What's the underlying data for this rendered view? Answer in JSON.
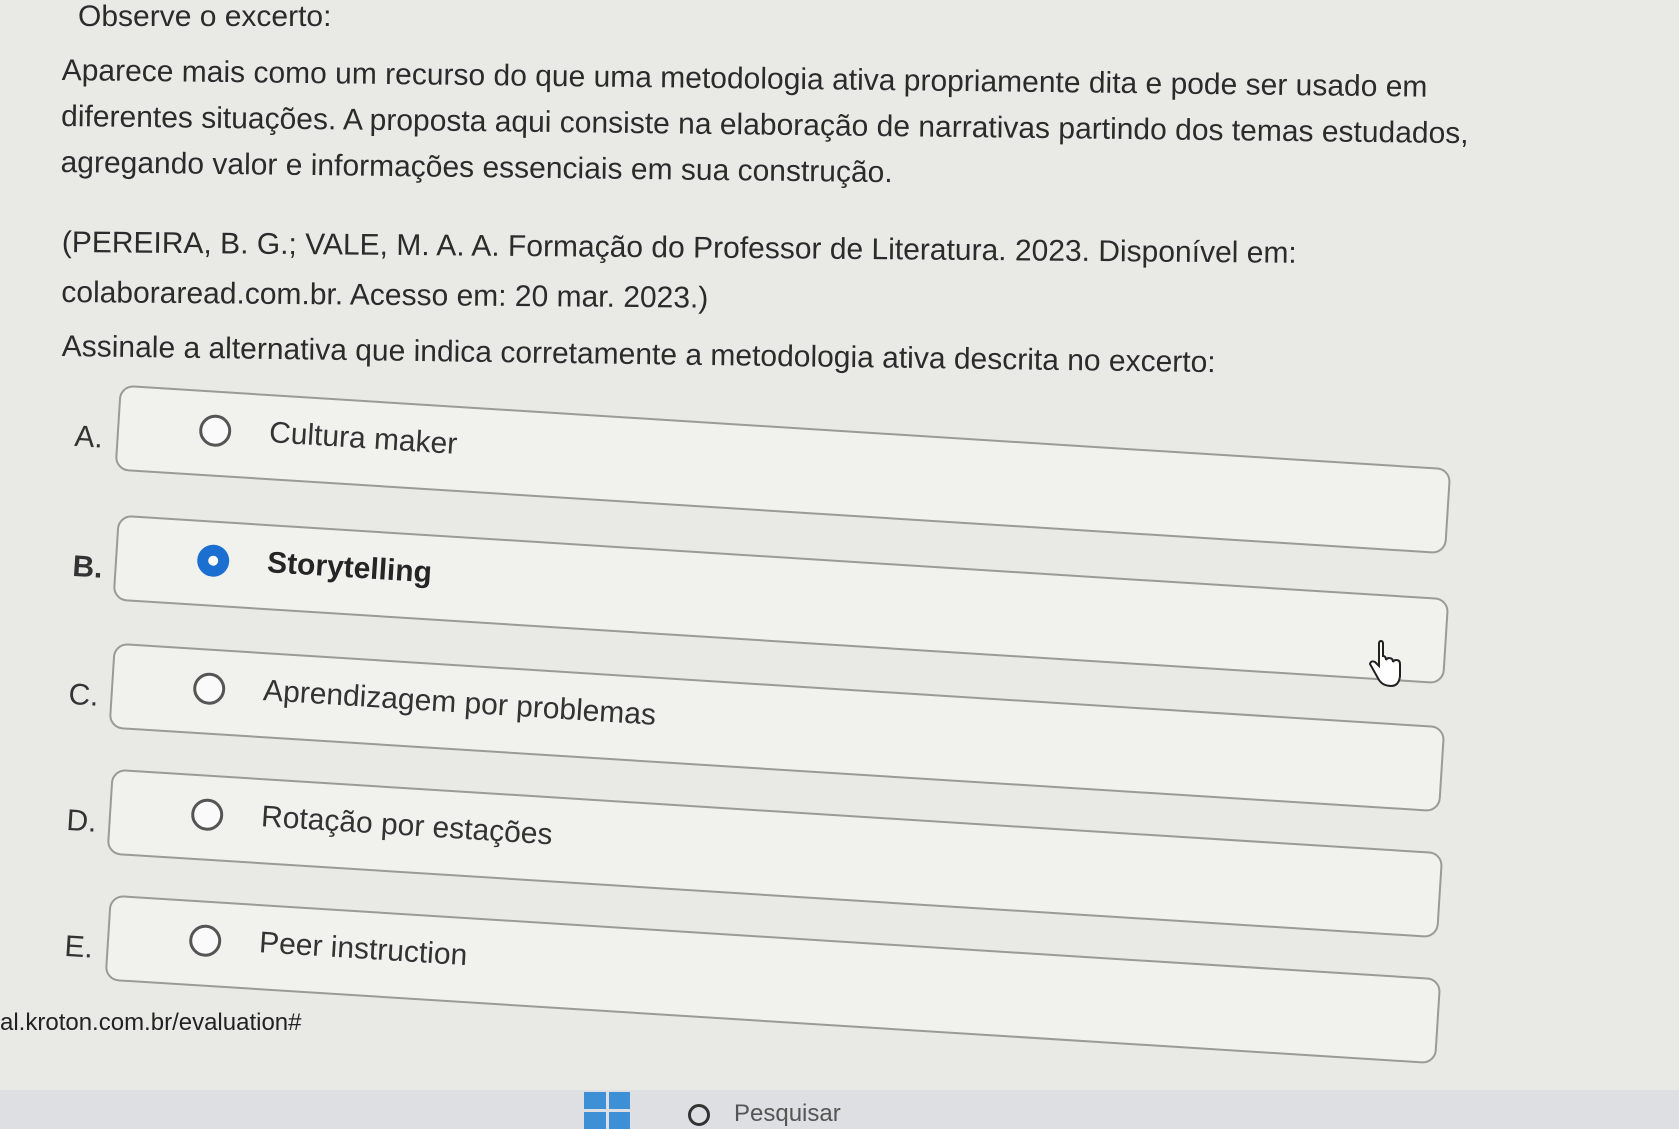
{
  "heading": "Observe o excerto:",
  "excerpt_lines": [
    "Aparece mais como um recurso do que uma metodologia ativa propriamente dita e pode ser usado em",
    "diferentes situações. A proposta aqui consiste na elaboração de narrativas partindo dos temas estudados,",
    "agregando valor e informações essenciais em sua construção."
  ],
  "citation": {
    "line1": "(PEREIRA, B. G.; VALE, M. A. A. Formação do Professor de Literatura. 2023. Disponível em:",
    "line2": "colaboraread.com.br. Acesso em: 20 mar. 2023.)"
  },
  "instruction": "Assinale a alternativa que indica corretamente a metodologia ativa descrita no excerto:",
  "options": [
    {
      "letter": "A.",
      "label": "Cultura maker",
      "selected": false
    },
    {
      "letter": "B.",
      "label": "Storytelling",
      "selected": true
    },
    {
      "letter": "C.",
      "label": "Aprendizagem por problemas",
      "selected": false
    },
    {
      "letter": "D.",
      "label": "Rotação por estações",
      "selected": false
    },
    {
      "letter": "E.",
      "label": "Peer instruction",
      "selected": false
    }
  ],
  "status_url": "al.kroton.com.br/evaluation#",
  "taskbar": {
    "search_label": "Pesquisar",
    "start_icon": "windows-icon",
    "search_icon": "search-icon"
  },
  "colors": {
    "accent": "#1a6fd0",
    "background": "#e9e9e6"
  }
}
